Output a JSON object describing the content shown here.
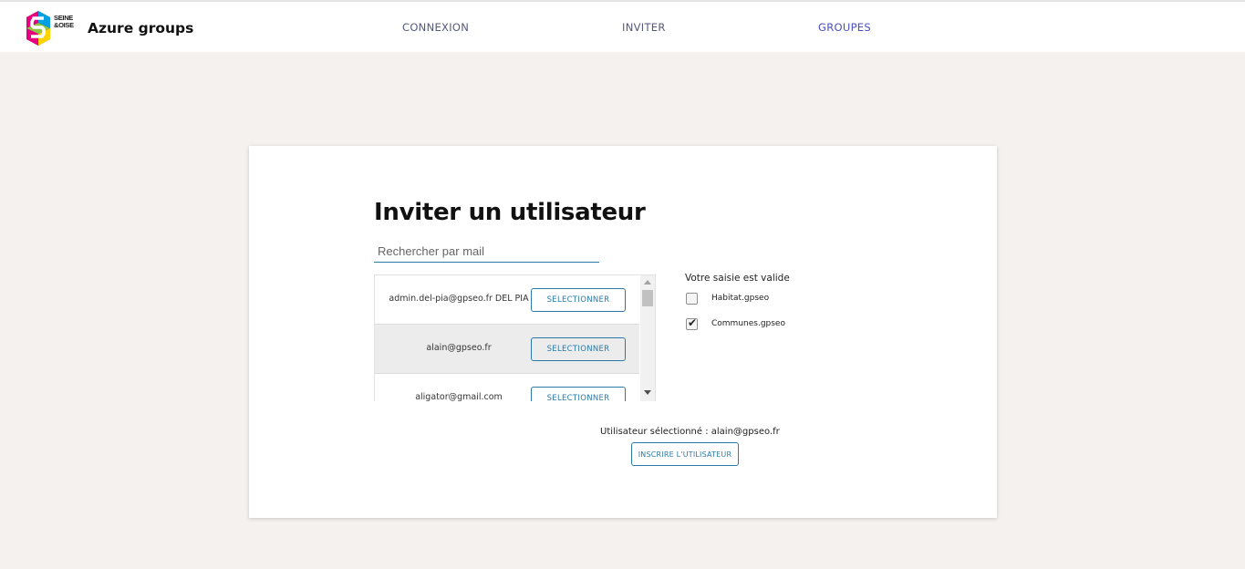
{
  "header": {
    "logo_text": [
      "SEINE",
      "&OISE"
    ],
    "app_title": "Azure groups",
    "nav": [
      {
        "label": "CONNEXION"
      },
      {
        "label": "INVITER"
      },
      {
        "label": "GROUPES"
      }
    ],
    "active_nav": "GROUPES"
  },
  "main": {
    "title": "Inviter un utilisateur",
    "search": {
      "placeholder": "Rechercher par mail",
      "value": ""
    },
    "users": [
      {
        "email": "admin.del-pia@gpseo.fr DEL PIA",
        "button": "SELECTIONNER",
        "selected": false
      },
      {
        "email": "alain@gpseo.fr",
        "button": "SELECTIONNER",
        "selected": true
      },
      {
        "email": "aligator@gmail.com",
        "button": "SELECTIONNER",
        "selected": false
      }
    ],
    "validation_message": "Votre saisie est valide",
    "groups": [
      {
        "label": "Habitat.gpseo",
        "checked": false
      },
      {
        "label": "Communes.gpseo",
        "checked": true
      }
    ],
    "selected_user_text": "Utilisateur sélectionné : alain@gpseo.fr",
    "register_button": "INSCRIRE L'UTILISATEUR"
  },
  "colors": {
    "accent": "#2a7aa8",
    "active_nav": "#4a4fbf",
    "background": "#f4f1ee"
  }
}
